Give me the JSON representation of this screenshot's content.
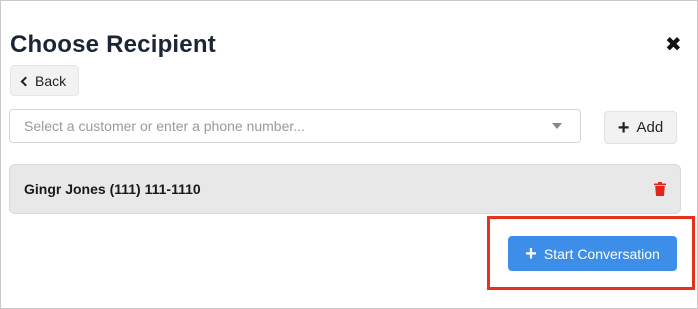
{
  "modal": {
    "title": "Choose Recipient",
    "close_glyph": "✖",
    "back_label": "Back",
    "search": {
      "placeholder": "Select a customer or enter a phone number...",
      "value": ""
    },
    "add_label": "Add",
    "add_glyph": "+",
    "recipients": [
      {
        "label": "Gingr Jones (111) 111-1110"
      }
    ],
    "start_label": "Start Conversation",
    "start_glyph": "+"
  },
  "icons": {
    "close": "close-icon",
    "back": "chevron-left-icon",
    "caret": "caret-down-icon",
    "add": "plus-icon",
    "delete": "trash-icon",
    "start": "plus-icon"
  },
  "colors": {
    "primary_button": "#3d8ee8",
    "delete_icon": "#e3251d",
    "highlight_outline": "#e8301f",
    "title_text": "#1c2536"
  }
}
